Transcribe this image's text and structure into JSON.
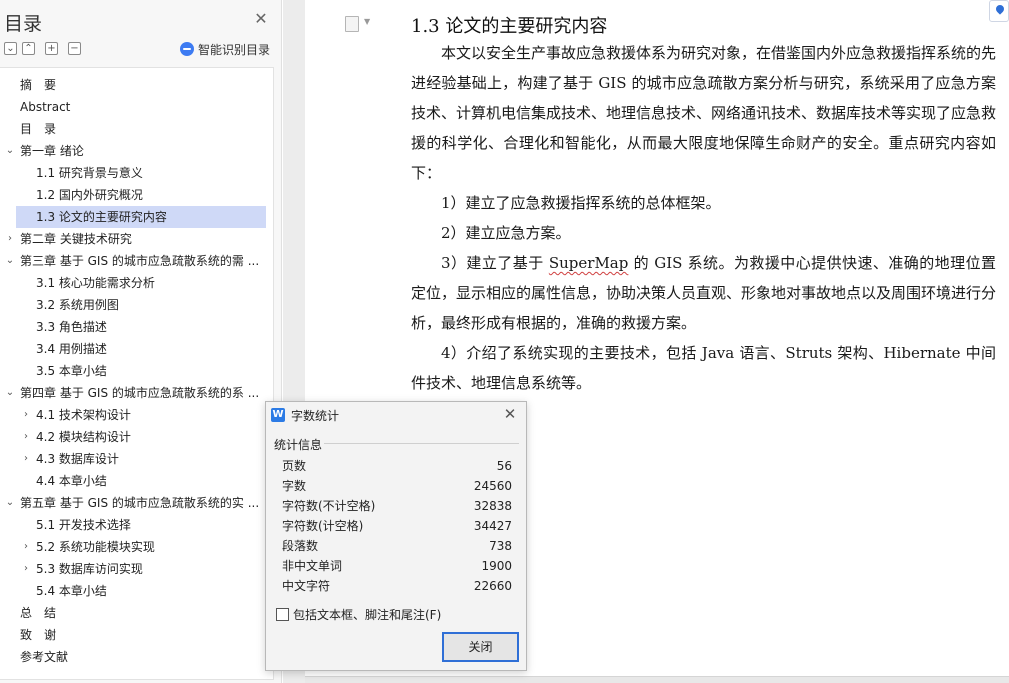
{
  "toc": {
    "title": "目录",
    "smart_toc_label": "智能识别目录",
    "items": [
      {
        "label": "摘　要",
        "level": 0,
        "chevron": ""
      },
      {
        "label": "Abstract",
        "level": 0,
        "chevron": ""
      },
      {
        "label": "目　录",
        "level": 0,
        "chevron": ""
      },
      {
        "label": "第一章  绪论",
        "level": 0,
        "chevron": "expanded"
      },
      {
        "label": "1.1  研究背景与意义",
        "level": 1,
        "chevron": ""
      },
      {
        "label": "1.2  国内外研究概况",
        "level": 1,
        "chevron": ""
      },
      {
        "label": "1.3  论文的主要研究内容",
        "level": 1,
        "chevron": "",
        "selected": true
      },
      {
        "label": "第二章  关键技术研究",
        "level": 0,
        "chevron": "collapsed"
      },
      {
        "label": "第三章  基于 GIS 的城市应急疏散系统的需 ...",
        "level": 0,
        "chevron": "expanded"
      },
      {
        "label": "3.1  核心功能需求分析",
        "level": 1,
        "chevron": ""
      },
      {
        "label": "3.2  系统用例图",
        "level": 1,
        "chevron": ""
      },
      {
        "label": "3.3  角色描述",
        "level": 1,
        "chevron": ""
      },
      {
        "label": "3.4  用例描述",
        "level": 1,
        "chevron": ""
      },
      {
        "label": "3.5  本章小结",
        "level": 1,
        "chevron": ""
      },
      {
        "label": "第四章  基于 GIS 的城市应急疏散系统的系 ...",
        "level": 0,
        "chevron": "expanded"
      },
      {
        "label": "4.1    技术架构设计",
        "level": 1,
        "chevron": "collapsed"
      },
      {
        "label": "4.2  模块结构设计",
        "level": 1,
        "chevron": "collapsed"
      },
      {
        "label": "4.3  数据库设计",
        "level": 1,
        "chevron": "collapsed"
      },
      {
        "label": "4.4  本章小结",
        "level": 1,
        "chevron": ""
      },
      {
        "label": "第五章  基于 GIS 的城市应急疏散系统的实 ...",
        "level": 0,
        "chevron": "expanded"
      },
      {
        "label": "5.1  开发技术选择",
        "level": 1,
        "chevron": ""
      },
      {
        "label": "5.2  系统功能模块实现",
        "level": 1,
        "chevron": "collapsed"
      },
      {
        "label": "5.3  数据库访问实现",
        "level": 1,
        "chevron": "collapsed"
      },
      {
        "label": "5.4  本章小结",
        "level": 1,
        "chevron": ""
      },
      {
        "label": "总　结",
        "level": 0,
        "chevron": ""
      },
      {
        "label": "致　谢",
        "level": 0,
        "chevron": ""
      },
      {
        "label": "参考文献",
        "level": 0,
        "chevron": ""
      }
    ]
  },
  "document": {
    "heading": "1.3  论文的主要研究内容",
    "intro": "本文以安全生产事故应急救援体系为研究对象，在借鉴国内外应急救援指挥系统的先进经验基础上，构建了基于 GIS 的城市应急疏散方案分析与研究，系统采用了应急方案技术、计算机电信集成技术、地理信息技术、网络通讯技术、数据库技术等实现了应急救援的科学化、合理化和智能化，从而最大限度地保障生命财产的安全。重点研究内容如下：",
    "point1": "1）建立了应急救援指挥系统的总体框架。",
    "point2": "2）建立应急方案。",
    "point3_before": "3）建立了基于 ",
    "point3_squiggle": "SuperMap",
    "point3_after": " 的 GIS 系统。为救援中心提供快速、准确的地理位置定位，显示相应的属性信息，协助决策人员直观、形象地对事故地点以及周围环境进行分析，最终形成有根据的，准确的救援方案。",
    "point4": "4）介绍了系统实现的主要技术，包括 Java 语言、Struts 架构、Hibernate 中间件技术、地理信息系统等。"
  },
  "dialog": {
    "title": "字数统计",
    "group_label": "统计信息",
    "stats": [
      {
        "label": "页数",
        "value": "56"
      },
      {
        "label": "字数",
        "value": "24560"
      },
      {
        "label": "字符数(不计空格)",
        "value": "32838"
      },
      {
        "label": "字符数(计空格)",
        "value": "34427"
      },
      {
        "label": "段落数",
        "value": "738"
      },
      {
        "label": "非中文单词",
        "value": "1900"
      },
      {
        "label": "中文字符",
        "value": "22660"
      }
    ],
    "include_label": "包括文本框、脚注和尾注(F)",
    "include_checked": false,
    "close_label": "关闭"
  },
  "colors": {
    "accent": "#2f6fd6",
    "selection": "#cfd9f7",
    "app_icon": "#2c7be5"
  }
}
